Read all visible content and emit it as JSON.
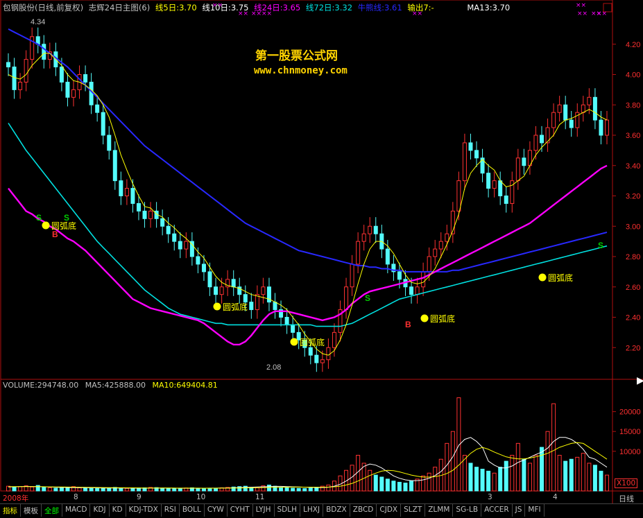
{
  "header": {
    "stock": "包钢股份(日线,前复权)",
    "formula": "志辉24日主图(6)",
    "items": [
      {
        "text": "线5日:3.70",
        "color": "#ffff00"
      },
      {
        "text": "线10日:3.75",
        "color": "#ffffff"
      },
      {
        "text": "线24日:3.65",
        "color": "#ff00ff"
      },
      {
        "text": "线72日:3.32",
        "color": "#00e0e0"
      },
      {
        "text": "牛熊线:3.61",
        "color": "#2828ff"
      },
      {
        "text": "输出7:-",
        "color": "#ffff00"
      },
      {
        "text": "MA13:3.70",
        "color": "#ffffff"
      }
    ]
  },
  "watermark": {
    "line1": "第一股票公式网",
    "line2": "www.chnmoney.com"
  },
  "price_chart": {
    "high_label": "4.34",
    "low_label": "2.08",
    "signals": [
      "圆弧底",
      "圆弧底",
      "圆弧底",
      "圆弧底",
      "圆弧底",
      "圆弧底"
    ],
    "marks": {
      "sell": "S",
      "buy": "B"
    }
  },
  "volume_header": {
    "volume": "VOLUME:294748.00",
    "ma5": "MA5:425888.00",
    "ma10": "MA10:649404.81"
  },
  "volume_axis": {
    "ticks": [
      "20000",
      "15000",
      "10000"
    ],
    "unit": "X100"
  },
  "date_axis": {
    "labels": [
      "2008年",
      "8",
      "9",
      "10",
      "11",
      "3",
      "4"
    ],
    "right_label": "日线"
  },
  "tabs": [
    "指标",
    "模板",
    "全部",
    "MACD",
    "KDJ",
    "KD",
    "KDJ-TDX",
    "RSI",
    "BOLL",
    "CYW",
    "CYHT",
    "LYJH",
    "SDLH",
    "LHXJ",
    "BDZX",
    "ZBCD",
    "CJDX",
    "SLZT",
    "ZLMM",
    "SG-LB",
    "ACCER",
    "JS",
    "MFI"
  ],
  "chart_data": {
    "type": "candlestick",
    "title": "包钢股份(日线,前复权)",
    "y_axis": {
      "ticks": [
        2.2,
        2.4,
        2.6,
        2.8,
        3.0,
        3.2,
        3.4,
        3.6,
        3.8,
        4.0,
        4.2
      ],
      "ylim": [
        2.0,
        4.4
      ]
    },
    "close_series": [
      4.05,
      3.9,
      3.95,
      4.1,
      4.25,
      4.2,
      4.1,
      4.15,
      4.05,
      3.95,
      3.85,
      3.9,
      4.0,
      3.95,
      3.8,
      3.75,
      3.6,
      3.5,
      3.3,
      3.2,
      3.25,
      3.15,
      3.1,
      3.05,
      3.1,
      3.05,
      3.0,
      2.95,
      2.9,
      2.85,
      2.9,
      2.8,
      2.75,
      2.7,
      2.6,
      2.55,
      2.6,
      2.65,
      2.6,
      2.55,
      2.5,
      2.45,
      2.55,
      2.6,
      2.5,
      2.45,
      2.4,
      2.35,
      2.3,
      2.25,
      2.2,
      2.15,
      2.1,
      2.12,
      2.2,
      2.3,
      2.45,
      2.6,
      2.75,
      2.9,
      2.95,
      3.0,
      2.95,
      2.85,
      2.75,
      2.7,
      2.65,
      2.6,
      2.55,
      2.6,
      2.7,
      2.8,
      2.85,
      2.9,
      2.95,
      3.1,
      3.3,
      3.55,
      3.5,
      3.45,
      3.35,
      3.25,
      3.3,
      3.2,
      3.15,
      3.3,
      3.45,
      3.4,
      3.5,
      3.6,
      3.55,
      3.65,
      3.75,
      3.8,
      3.7,
      3.65,
      3.75,
      3.8,
      3.85,
      3.7,
      3.6,
      3.7
    ],
    "ma5": [
      4.0,
      3.98,
      3.97,
      4.0,
      4.06,
      4.1,
      4.14,
      4.14,
      4.1,
      4.06,
      4.0,
      3.96,
      3.95,
      3.93,
      3.9,
      3.86,
      3.8,
      3.72,
      3.6,
      3.47,
      3.37,
      3.28,
      3.2,
      3.13,
      3.12,
      3.08,
      3.06,
      3.02,
      2.99,
      2.95,
      2.92,
      2.88,
      2.83,
      2.79,
      2.73,
      2.67,
      2.63,
      2.61,
      2.6,
      2.59,
      2.57,
      2.55,
      2.54,
      2.53,
      2.52,
      2.5,
      2.48,
      2.45,
      2.4,
      2.35,
      2.29,
      2.24,
      2.19,
      2.16,
      2.15,
      2.18,
      2.25,
      2.35,
      2.48,
      2.62,
      2.75,
      2.85,
      2.9,
      2.9,
      2.87,
      2.82,
      2.75,
      2.68,
      2.63,
      2.62,
      2.63,
      2.67,
      2.72,
      2.8,
      2.88,
      2.97,
      3.08,
      3.25,
      3.35,
      3.4,
      3.44,
      3.4,
      3.37,
      3.3,
      3.26,
      3.27,
      3.3,
      3.33,
      3.4,
      3.47,
      3.52,
      3.56,
      3.6,
      3.67,
      3.7,
      3.71,
      3.73,
      3.75,
      3.77,
      3.75,
      3.72,
      3.7
    ],
    "ma24": [
      3.25,
      3.2,
      3.15,
      3.1,
      3.08,
      3.05,
      3.03,
      3.0,
      2.98,
      2.95,
      2.92,
      2.9,
      2.87,
      2.84,
      2.8,
      2.76,
      2.72,
      2.68,
      2.64,
      2.6,
      2.56,
      2.52,
      2.5,
      2.48,
      2.46,
      2.45,
      2.44,
      2.43,
      2.42,
      2.41,
      2.4,
      2.39,
      2.38,
      2.36,
      2.33,
      2.3,
      2.27,
      2.24,
      2.22,
      2.22,
      2.24,
      2.28,
      2.33,
      2.38,
      2.42,
      2.44,
      2.44,
      2.44,
      2.43,
      2.42,
      2.41,
      2.4,
      2.39,
      2.38,
      2.39,
      2.4,
      2.42,
      2.45,
      2.49,
      2.52,
      2.55,
      2.57,
      2.58,
      2.59,
      2.6,
      2.61,
      2.62,
      2.63,
      2.64,
      2.65,
      2.66,
      2.68,
      2.7,
      2.72,
      2.74,
      2.76,
      2.78,
      2.8,
      2.82,
      2.84,
      2.86,
      2.88,
      2.9,
      2.92,
      2.94,
      2.96,
      2.98,
      3.0,
      3.02,
      3.05,
      3.08,
      3.11,
      3.14,
      3.17,
      3.2,
      3.23,
      3.26,
      3.29,
      3.32,
      3.35,
      3.38,
      3.4
    ],
    "ma72": [
      3.68,
      3.62,
      3.56,
      3.5,
      3.45,
      3.4,
      3.35,
      3.3,
      3.25,
      3.2,
      3.15,
      3.1,
      3.05,
      3.0,
      2.95,
      2.9,
      2.86,
      2.82,
      2.78,
      2.74,
      2.7,
      2.66,
      2.62,
      2.58,
      2.55,
      2.52,
      2.49,
      2.46,
      2.44,
      2.42,
      2.41,
      2.4,
      2.39,
      2.38,
      2.37,
      2.36,
      2.36,
      2.35,
      2.35,
      2.35,
      2.35,
      2.35,
      2.35,
      2.35,
      2.35,
      2.35,
      2.35,
      2.35,
      2.35,
      2.35,
      2.35,
      2.35,
      2.34,
      2.34,
      2.34,
      2.34,
      2.34,
      2.35,
      2.36,
      2.38,
      2.4,
      2.42,
      2.44,
      2.46,
      2.48,
      2.5,
      2.52,
      2.53,
      2.54,
      2.55,
      2.56,
      2.57,
      2.58,
      2.59,
      2.6,
      2.61,
      2.62,
      2.63,
      2.64,
      2.65,
      2.66,
      2.67,
      2.68,
      2.69,
      2.7,
      2.71,
      2.72,
      2.73,
      2.74,
      2.75,
      2.76,
      2.77,
      2.78,
      2.79,
      2.8,
      2.81,
      2.82,
      2.83,
      2.84,
      2.85,
      2.86,
      2.87
    ],
    "bullbear": [
      4.3,
      4.28,
      4.26,
      4.24,
      4.22,
      4.2,
      4.17,
      4.14,
      4.11,
      4.08,
      4.05,
      4.01,
      3.97,
      3.93,
      3.89,
      3.85,
      3.81,
      3.77,
      3.73,
      3.69,
      3.65,
      3.61,
      3.57,
      3.53,
      3.5,
      3.47,
      3.44,
      3.41,
      3.38,
      3.35,
      3.32,
      3.29,
      3.26,
      3.23,
      3.2,
      3.17,
      3.14,
      3.11,
      3.08,
      3.05,
      3.02,
      3.0,
      2.98,
      2.96,
      2.94,
      2.92,
      2.9,
      2.88,
      2.86,
      2.84,
      2.83,
      2.82,
      2.81,
      2.8,
      2.79,
      2.78,
      2.77,
      2.76,
      2.75,
      2.74,
      2.74,
      2.73,
      2.73,
      2.72,
      2.72,
      2.71,
      2.71,
      2.7,
      2.7,
      2.7,
      2.7,
      2.7,
      2.7,
      2.7,
      2.7,
      2.71,
      2.71,
      2.72,
      2.73,
      2.74,
      2.75,
      2.76,
      2.77,
      2.78,
      2.79,
      2.8,
      2.81,
      2.82,
      2.83,
      2.84,
      2.85,
      2.86,
      2.87,
      2.88,
      2.89,
      2.9,
      2.91,
      2.92,
      2.93,
      2.94,
      2.95,
      2.96
    ],
    "volume_axis": {
      "ticks": [
        10000,
        15000,
        20000
      ],
      "ylim": [
        0,
        25000
      ]
    },
    "volume": [
      1200,
      900,
      1100,
      1300,
      1000,
      1400,
      900,
      800,
      700,
      850,
      900,
      1100,
      800,
      700,
      650,
      600,
      750,
      800,
      900,
      700,
      650,
      600,
      750,
      800,
      900,
      850,
      700,
      650,
      600,
      700,
      750,
      800,
      650,
      600,
      550,
      700,
      800,
      900,
      1000,
      1100,
      1200,
      900,
      800,
      1300,
      1500,
      1200,
      900,
      800,
      700,
      650,
      600,
      700,
      900,
      1200,
      1500,
      2500,
      3800,
      5200,
      6500,
      9000,
      7000,
      5200,
      4000,
      3500,
      3000,
      2500,
      2200,
      2000,
      2500,
      3000,
      3800,
      4500,
      6000,
      8000,
      12000,
      15000,
      23500,
      9000,
      7000,
      6000,
      5500,
      5000,
      4500,
      6000,
      7500,
      9000,
      12000,
      8000,
      7000,
      9000,
      11000,
      15000,
      22000,
      9000,
      7500,
      8000,
      8500,
      9500,
      7000,
      6500,
      5000,
      4000
    ],
    "vol_ma5": [
      1000,
      1050,
      1100,
      1150,
      1120,
      1100,
      1050,
      1000,
      950,
      900,
      880,
      860,
      840,
      820,
      800,
      780,
      760,
      750,
      740,
      730,
      720,
      710,
      700,
      700,
      710,
      720,
      730,
      720,
      700,
      690,
      680,
      680,
      690,
      700,
      710,
      720,
      740,
      760,
      800,
      850,
      900,
      950,
      1000,
      1050,
      1100,
      1150,
      1150,
      1100,
      1050,
      1000,
      950,
      900,
      850,
      850,
      950,
      1200,
      1700,
      2500,
      3500,
      4800,
      6200,
      6800,
      6500,
      5800,
      4800,
      3800,
      3200,
      2800,
      2600,
      2600,
      2800,
      3200,
      3900,
      4900,
      6500,
      8600,
      11500,
      13000,
      13500,
      12500,
      11000,
      7500,
      6500,
      5800,
      5800,
      6300,
      7200,
      7800,
      8500,
      9200,
      9800,
      10800,
      12500,
      13500,
      13500,
      13000,
      12000,
      10500,
      8500,
      8000,
      7000,
      6000
    ],
    "vol_ma10": [
      1100,
      1100,
      1100,
      1100,
      1100,
      1080,
      1060,
      1040,
      1020,
      1000,
      980,
      960,
      940,
      920,
      900,
      880,
      860,
      840,
      820,
      800,
      790,
      780,
      770,
      760,
      750,
      745,
      740,
      735,
      730,
      725,
      720,
      715,
      710,
      705,
      700,
      705,
      710,
      720,
      740,
      760,
      780,
      800,
      830,
      860,
      890,
      920,
      950,
      970,
      980,
      980,
      970,
      960,
      950,
      950,
      980,
      1050,
      1200,
      1500,
      1900,
      2500,
      3200,
      3900,
      4500,
      5000,
      5200,
      5100,
      4800,
      4400,
      4000,
      3700,
      3500,
      3500,
      3600,
      3900,
      4400,
      5200,
      6500,
      8000,
      9500,
      10500,
      11000,
      10500,
      9800,
      9200,
      8600,
      8300,
      8100,
      8100,
      8300,
      8600,
      9000,
      9500,
      10200,
      11000,
      11500,
      12000,
      12200,
      12000,
      11000,
      10000,
      9000,
      8000
    ],
    "buy_signals": [
      "圆弧底",
      "圆弧底",
      "圆弧底",
      "圆弧底",
      "圆弧底",
      "圆弧底"
    ]
  }
}
